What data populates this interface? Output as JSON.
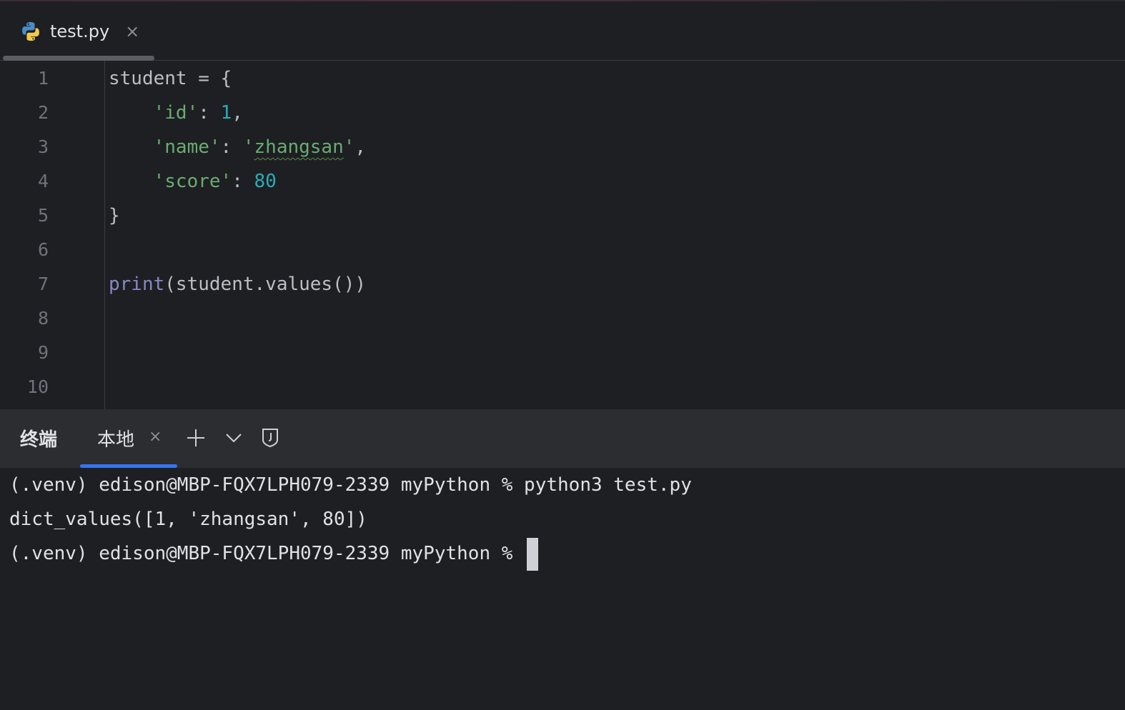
{
  "editor_tab": {
    "icon": "python-icon",
    "label": "test.py",
    "close": "×"
  },
  "editor": {
    "line_numbers": [
      "1",
      "2",
      "3",
      "4",
      "5",
      "6",
      "7",
      "8",
      "9",
      "10"
    ],
    "lines": [
      [
        {
          "t": "student = {",
          "c": ""
        }
      ],
      [
        {
          "t": "    ",
          "c": ""
        },
        {
          "t": "'id'",
          "c": "str"
        },
        {
          "t": ": ",
          "c": ""
        },
        {
          "t": "1",
          "c": "num"
        },
        {
          "t": ",",
          "c": ""
        }
      ],
      [
        {
          "t": "    ",
          "c": ""
        },
        {
          "t": "'name'",
          "c": "str"
        },
        {
          "t": ": ",
          "c": ""
        },
        {
          "t": "'",
          "c": "str"
        },
        {
          "t": "zhangsan",
          "c": "str squig"
        },
        {
          "t": "'",
          "c": "str"
        },
        {
          "t": ",",
          "c": ""
        }
      ],
      [
        {
          "t": "    ",
          "c": ""
        },
        {
          "t": "'score'",
          "c": "str"
        },
        {
          "t": ": ",
          "c": ""
        },
        {
          "t": "80",
          "c": "num"
        }
      ],
      [
        {
          "t": "}",
          "c": ""
        }
      ],
      [],
      [
        {
          "t": "print",
          "c": "fn"
        },
        {
          "t": "(student.values())",
          "c": ""
        }
      ],
      [],
      [],
      []
    ]
  },
  "terminal_panel": {
    "title": "终端",
    "tab_label": "本地",
    "tab_close": "×",
    "icons": [
      "plus-icon",
      "chevron-down-icon",
      "shield-icon"
    ],
    "lines": [
      "(.venv) edison@MBP-FQX7LPH079-2339 myPython % python3 test.py",
      "dict_values([1, 'zhangsan', 80])",
      "(.venv) edison@MBP-FQX7LPH079-2339 myPython % "
    ]
  },
  "colors": {
    "background": "#1e1f22",
    "panel_header": "#2b2d30",
    "string": "#6aab73",
    "number": "#2aacb8",
    "builtin": "#8888c6",
    "accent": "#3574f0"
  }
}
